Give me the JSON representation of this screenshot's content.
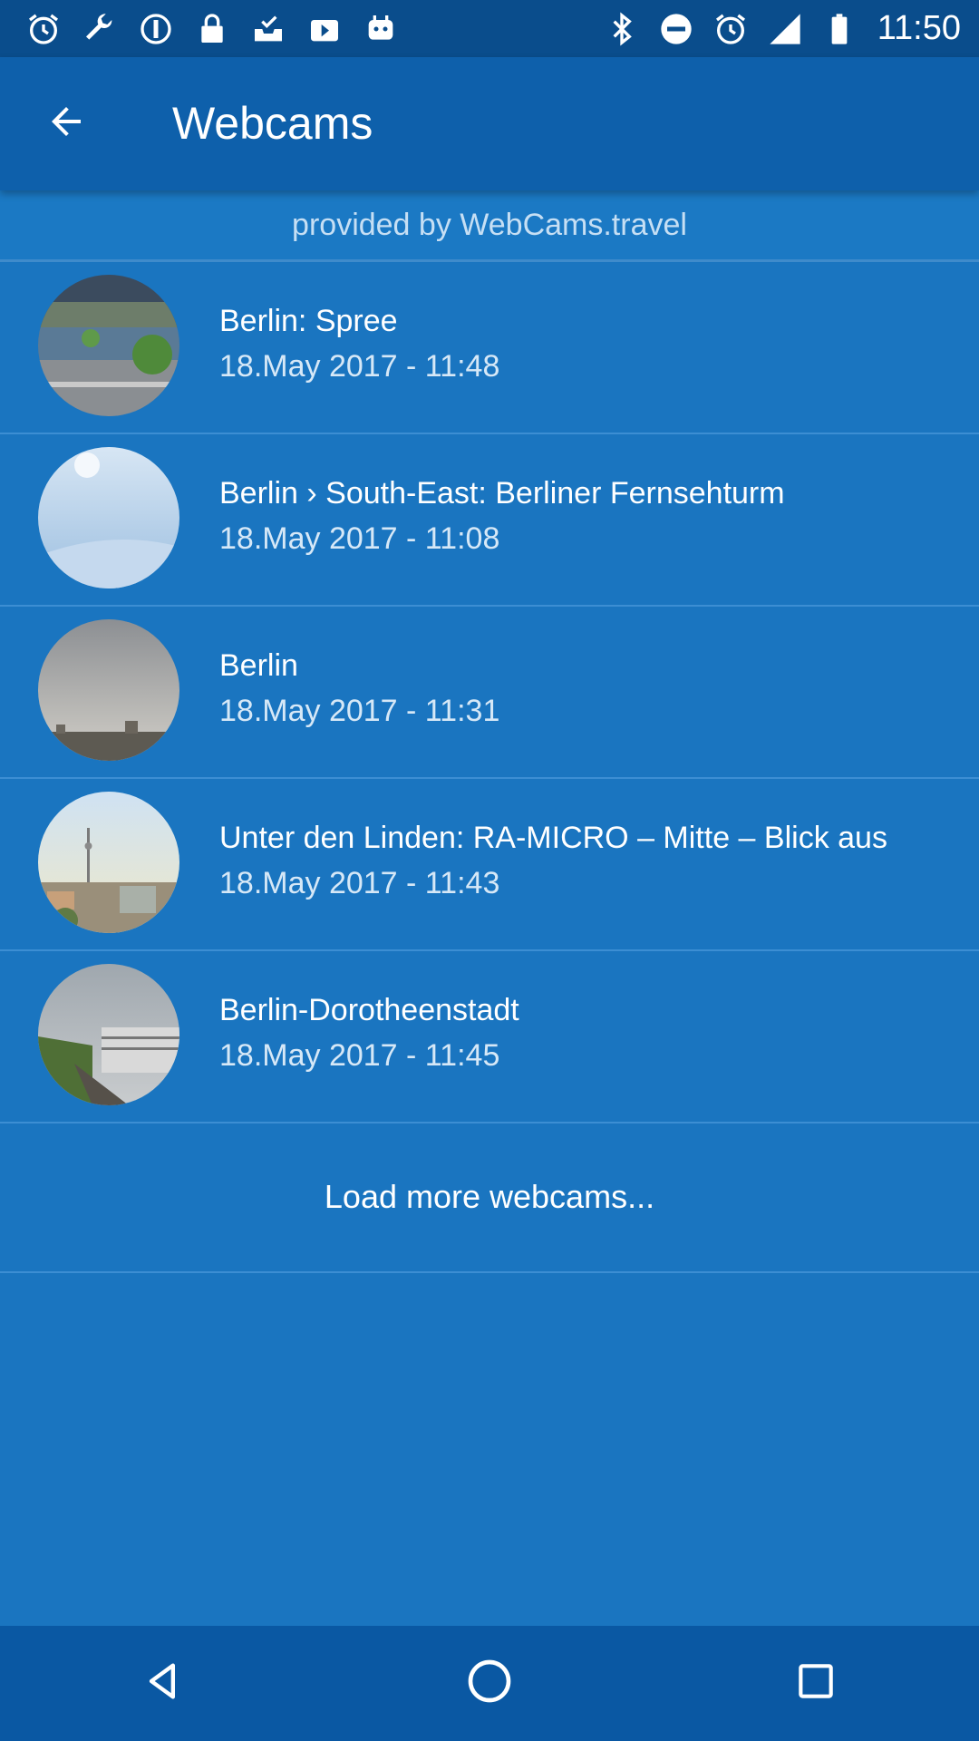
{
  "status_bar": {
    "time": "11:50",
    "left_icons": [
      "alarm-icon",
      "wrench-icon",
      "dash-circle-icon",
      "lock-icon",
      "inbox-check-icon",
      "play-icon",
      "robot-icon"
    ],
    "right_icons": [
      "bluetooth-icon",
      "do-not-disturb-icon",
      "alarm-icon",
      "signal-icon",
      "battery-icon"
    ]
  },
  "app_bar": {
    "title": "Webcams",
    "back_icon": "back-arrow-icon"
  },
  "provider_text": "provided by WebCams.travel",
  "webcams": [
    {
      "title": "Berlin: Spree",
      "date": "18.May 2017 - 11:48"
    },
    {
      "title": "Berlin › South-East: Berliner Fernsehturm",
      "date": "18.May 2017 - 11:08"
    },
    {
      "title": "Berlin",
      "date": "18.May 2017 - 11:31"
    },
    {
      "title": "Unter den Linden: RA-MICRO – Mitte – Blick aus",
      "date": "18.May 2017 - 11:43"
    },
    {
      "title": "Berlin-Dorotheenstadt",
      "date": "18.May 2017 - 11:45"
    }
  ],
  "load_more_label": "Load more webcams...",
  "nav_bar": {
    "icons": [
      "back-triangle-icon",
      "home-circle-icon",
      "recents-square-icon"
    ]
  },
  "colors": {
    "background": "#1a75c0",
    "app_bar": "#0e60ab",
    "status_bar": "#0a4d8c",
    "nav_bar": "#0a58a3"
  }
}
